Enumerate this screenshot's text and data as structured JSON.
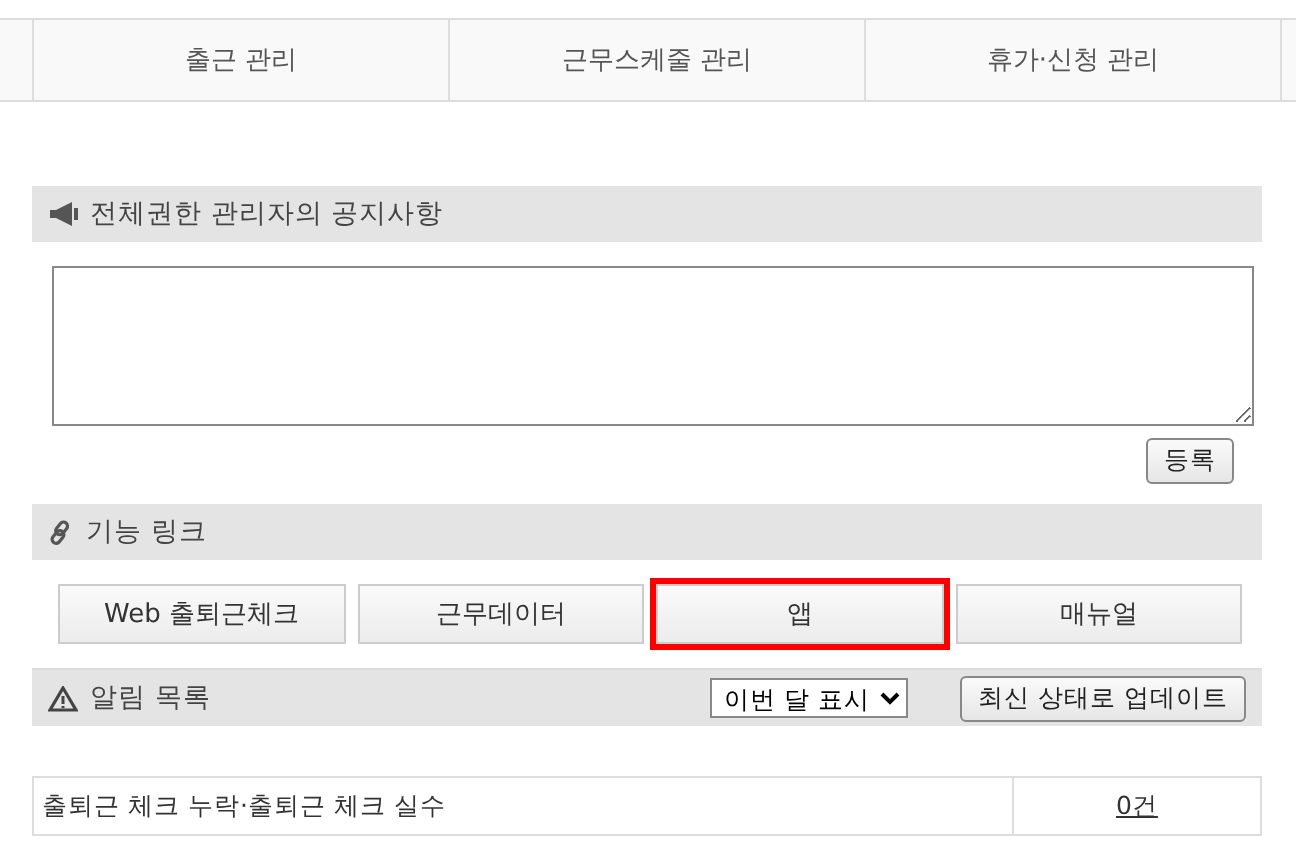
{
  "nav_tabs": [
    {
      "label": "출근 관리"
    },
    {
      "label": "근무스케줄 관리"
    },
    {
      "label": "휴가·신청 관리"
    }
  ],
  "notice": {
    "title": "전체권한 관리자의 공지사항",
    "register_button": "등록"
  },
  "links": {
    "title": "기능 링크",
    "buttons": [
      {
        "label": "Web 출퇴근체크",
        "highlighted": false
      },
      {
        "label": "근무데이터",
        "highlighted": false
      },
      {
        "label": "앱",
        "highlighted": true
      },
      {
        "label": "매뉴얼",
        "highlighted": false
      }
    ]
  },
  "alerts": {
    "title": "알림 목록",
    "period_select": "이번 달 표시",
    "update_button": "최신 상태로 업데이트",
    "rows": [
      {
        "label": "출퇴근 체크 누락·출퇴근 체크 실수",
        "count": "0건"
      }
    ]
  }
}
